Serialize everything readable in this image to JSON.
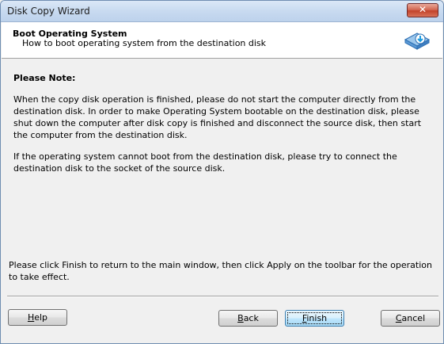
{
  "window": {
    "title": "Disk Copy Wizard",
    "close_glyph": "✕"
  },
  "header": {
    "title": "Boot Operating System",
    "subtitle": "How to boot operating system from the destination disk",
    "icon": "disk-boot-icon"
  },
  "content": {
    "note_title": "Please Note:",
    "paragraph1": "When the copy disk operation is finished, please do not start the computer directly from the destination disk. In order to make Operating System bootable on the destination disk, please shut down the computer after disk copy is finished and disconnect the source disk, then start the computer from the destination disk.",
    "paragraph2": "If the operating system cannot boot from the destination disk, please try to connect the destination disk to the socket of the source disk.",
    "finish_note": "Please click Finish to return to the main window, then click Apply on the toolbar for the operation to take effect."
  },
  "buttons": {
    "help": {
      "mnemonic": "H",
      "rest": "elp"
    },
    "back": {
      "mnemonic": "B",
      "rest": "ack"
    },
    "finish": {
      "mnemonic": "F",
      "rest": "inish"
    },
    "cancel": {
      "mnemonic": "C",
      "rest": "ancel"
    }
  },
  "colors": {
    "accent": "#3c7fb1",
    "close": "#c2432b",
    "header_bg": "#ffffff",
    "dialog_bg": "#f0f0f0"
  }
}
